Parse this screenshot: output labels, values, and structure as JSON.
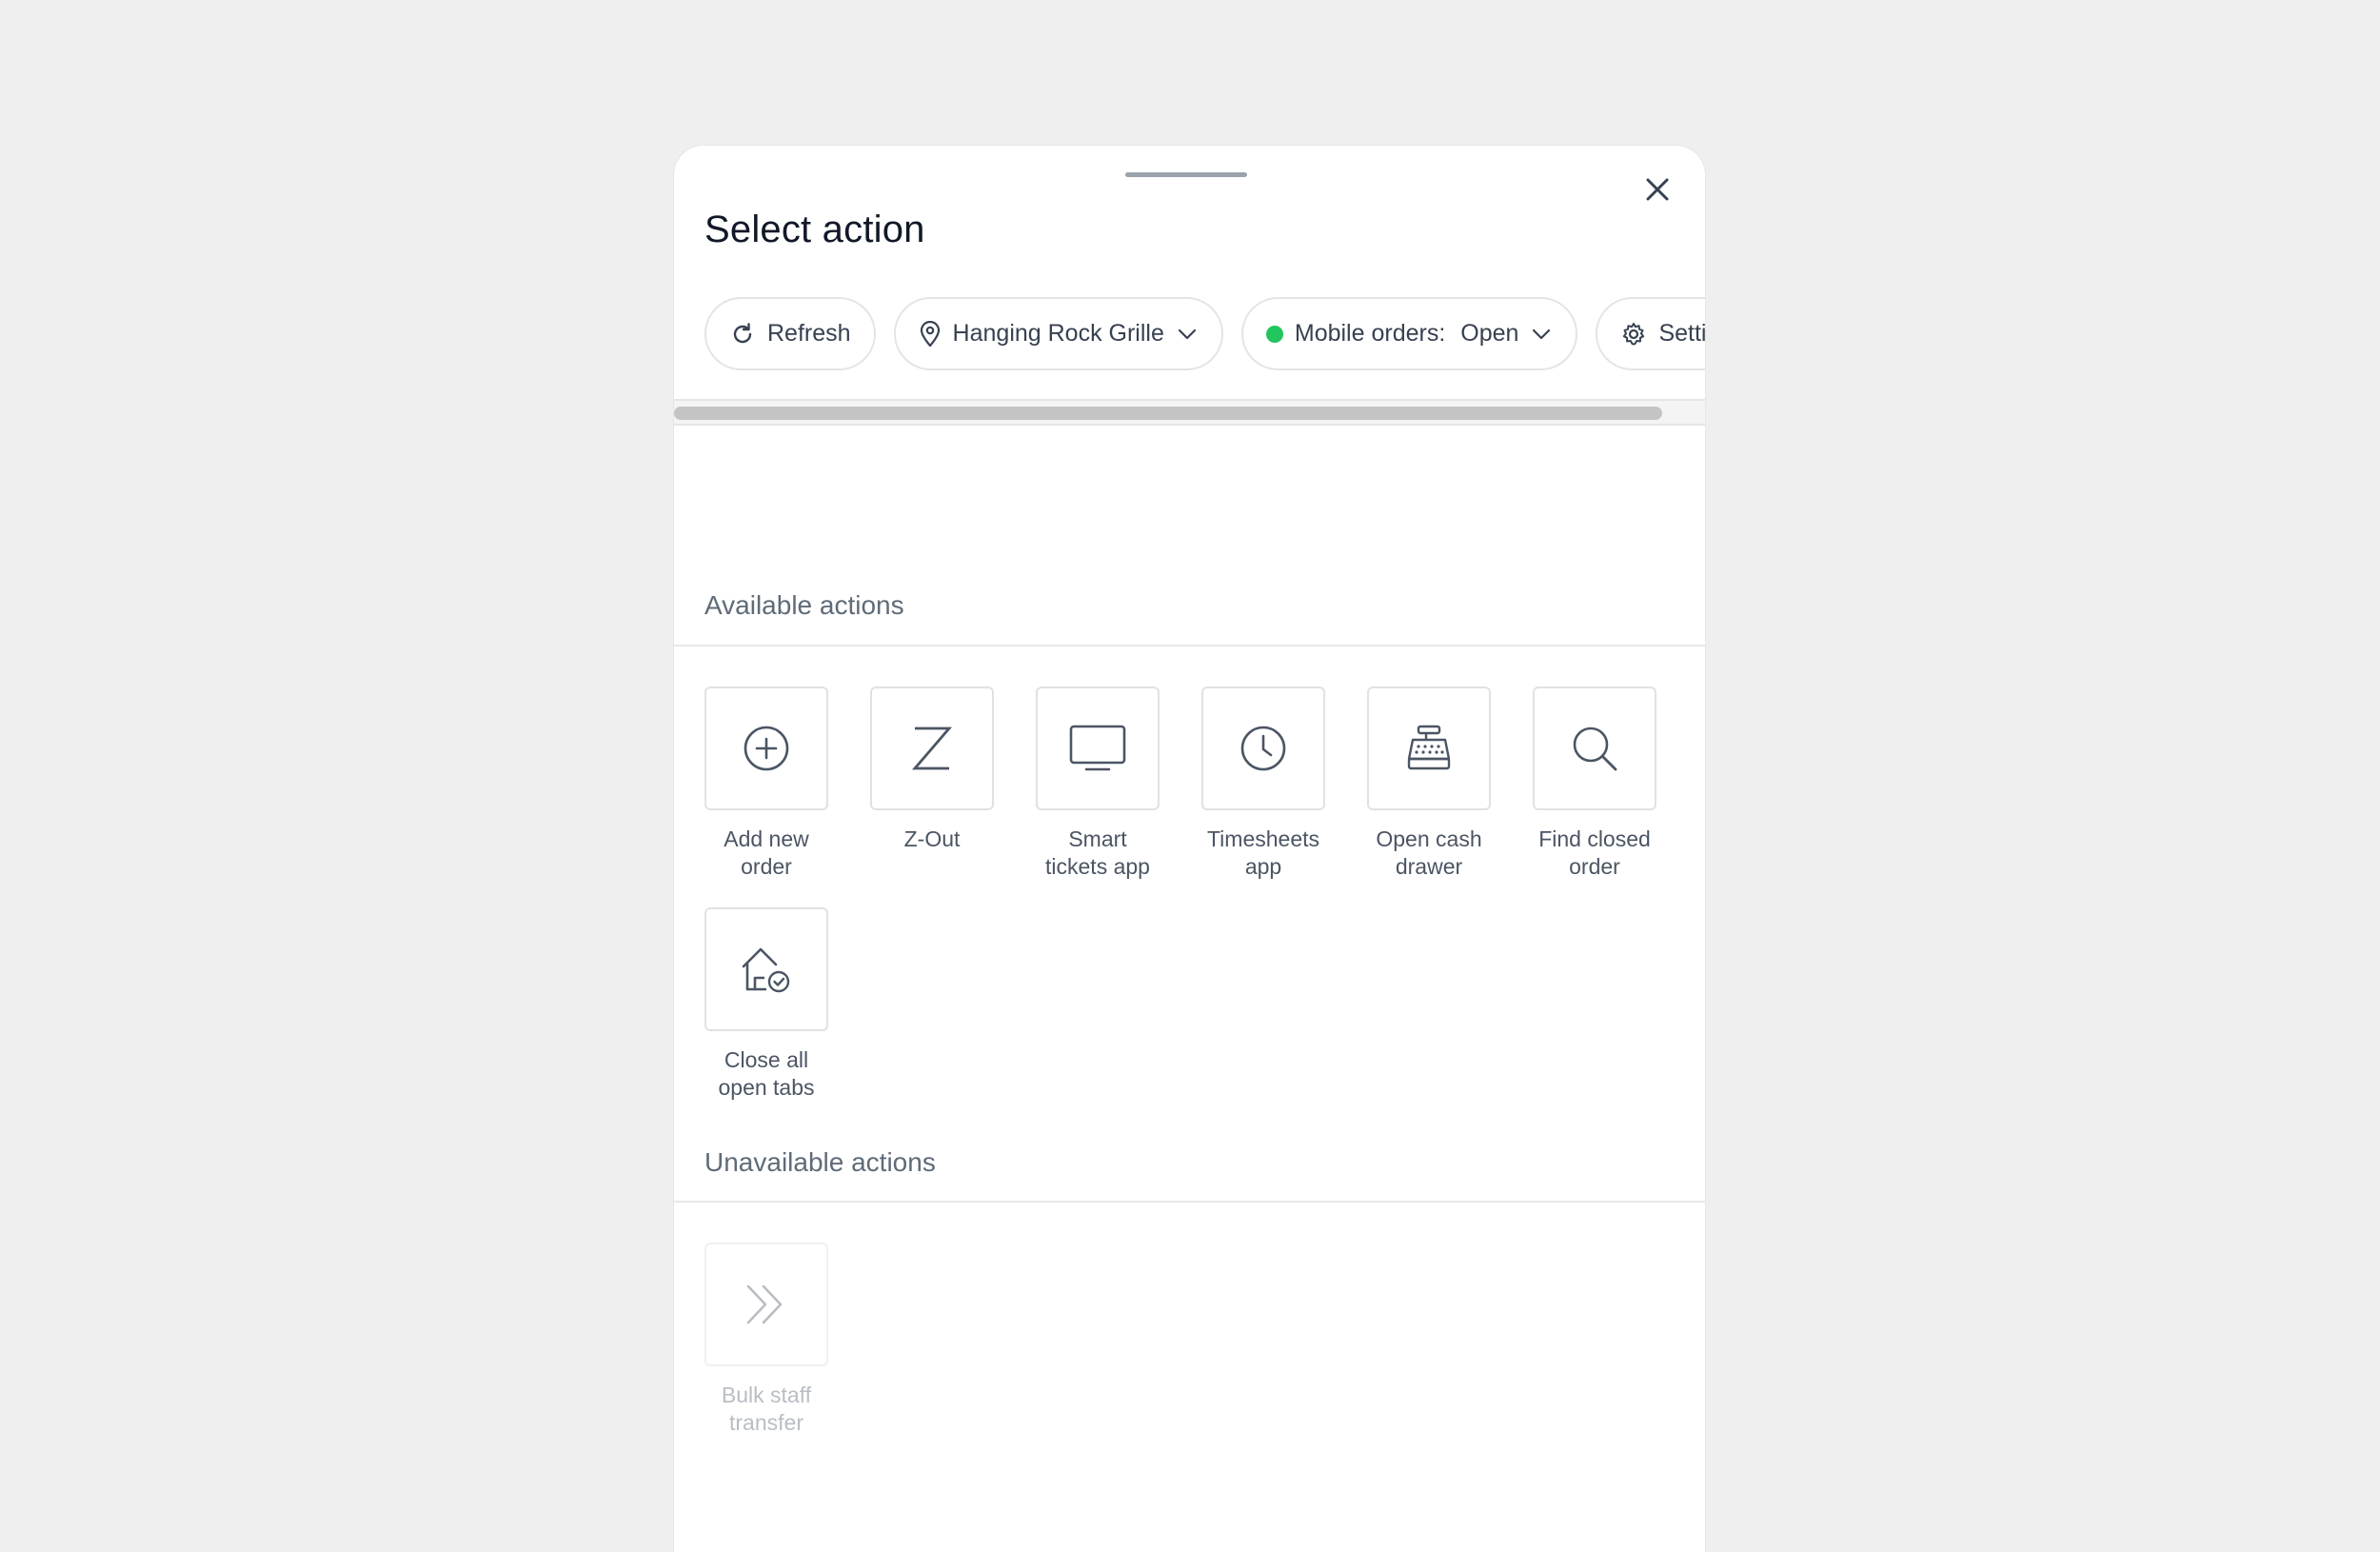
{
  "sheet": {
    "title": "Select action",
    "close_icon": "close-icon"
  },
  "chips": {
    "refresh": {
      "label": "Refresh",
      "icon": "refresh-icon"
    },
    "location": {
      "label": "Hanging Rock Grille",
      "icon": "location-pin-icon"
    },
    "mobile_orders": {
      "label": "Mobile orders:",
      "value": "Open",
      "status_color": "#22c55e"
    },
    "settings": {
      "label": "Settings",
      "icon": "gear-icon"
    }
  },
  "sections": {
    "available": "Available actions",
    "unavailable": "Unavailable actions"
  },
  "available_actions": [
    {
      "label_line1": "Add new",
      "label_line2": "order",
      "icon": "plus-circle-icon"
    },
    {
      "label_line1": "Z-Out",
      "label_line2": "",
      "icon": "z-letter-icon"
    },
    {
      "label_line1": "Smart",
      "label_line2": "tickets app",
      "icon": "monitor-icon"
    },
    {
      "label_line1": "Timesheets",
      "label_line2": "app",
      "icon": "clock-icon"
    },
    {
      "label_line1": "Open cash",
      "label_line2": "drawer",
      "icon": "cash-register-icon"
    },
    {
      "label_line1": "Find closed",
      "label_line2": "order",
      "icon": "search-icon"
    },
    {
      "label_line1": "Close all",
      "label_line2": "open tabs",
      "icon": "house-check-icon"
    }
  ],
  "unavailable_actions": [
    {
      "label_line1": "Bulk staff",
      "label_line2": "transfer",
      "icon": "double-chevron-right-icon"
    }
  ],
  "colors": {
    "background": "#efefef",
    "icon_stroke": "#4b5563",
    "disabled": "#b9bec4",
    "status_open": "#22c55e"
  }
}
